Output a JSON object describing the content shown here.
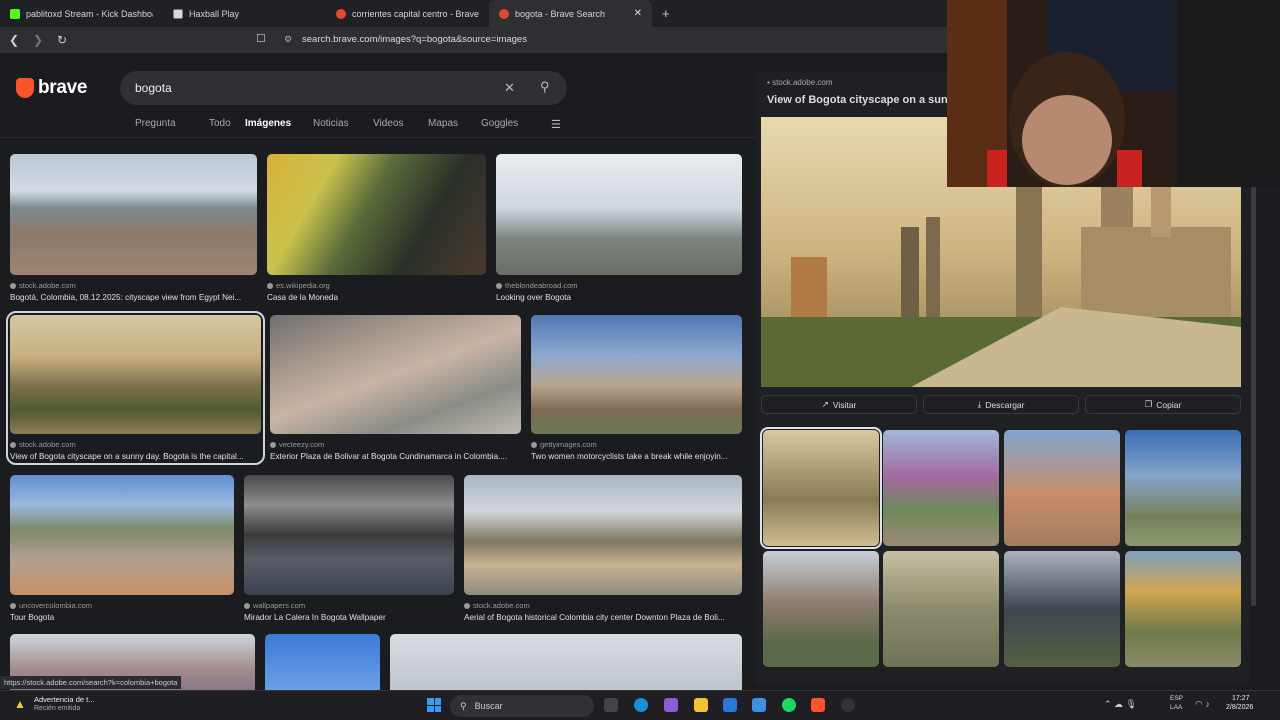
{
  "browser_tabs": [
    {
      "title": "pablitoxd Stream - Kick Dashboard",
      "favicon": "kick-icon"
    },
    {
      "title": "Haxball Play",
      "favicon": "haxball-icon"
    },
    {
      "title": "corrientes capital centro - Brave Sear",
      "favicon": "brave-icon"
    },
    {
      "title": "bogota - Brave Search",
      "favicon": "brave-icon",
      "active": true
    }
  ],
  "address_bar": {
    "url": "search.brave.com/images?q=bogota&source=images"
  },
  "brand": {
    "name": "brave",
    "accent": "#fb542b"
  },
  "search": {
    "query": "bogota"
  },
  "search_tabs": [
    "Pregunta",
    "Todo",
    "Imágenes",
    "Noticias",
    "Videos",
    "Mapas",
    "Goggles"
  ],
  "active_search_tab": "Imágenes",
  "results": [
    {
      "source": "stock.adobe.com",
      "caption": "Bogotá, Colombia, 08.12.2025: cityscape view from Egypt Nei..."
    },
    {
      "source": "es.wikipedia.org",
      "caption": "Casa de la Moneda"
    },
    {
      "source": "theblondeabroad.com",
      "caption": "Looking over Bogota"
    },
    {
      "source": "stock.adobe.com",
      "caption": "View of Bogota cityscape on a sunny day. Bogota is the capital...",
      "selected": true
    },
    {
      "source": "vecteezy.com",
      "caption": "Exterior Plaza de Bolivar at Bogota Cundinamarca in Colombia...."
    },
    {
      "source": "gettyimages.com",
      "caption": "Two women motorcyclists take a break while enjoyin..."
    },
    {
      "source": "uncovercolombia.com",
      "caption": "Tour Bogota"
    },
    {
      "source": "wallpapers.com",
      "caption": "Mirador La Calera In Bogota Wallpaper"
    },
    {
      "source": "stock.adobe.com",
      "caption": "Aerial of Bogota historical Colombia city center Downton Plaza de Boli..."
    }
  ],
  "preview": {
    "source": "stock.adobe.com",
    "title": "View of Bogota cityscape on a sunny day. Bogota is the capital...",
    "actions": {
      "visit": "Visitar",
      "download": "Descargar",
      "copy": "Copiar"
    }
  },
  "status_url": "https://stock.adobe.com/search?k=colombia+bogota",
  "taskbar": {
    "notification_title": "Advertencia de t...",
    "notification_sub": "Recién emitida",
    "search_label": "Buscar",
    "lang_line1": "ESP",
    "lang_line2": "LAA",
    "time": "17:27",
    "date": "2/8/2026"
  }
}
